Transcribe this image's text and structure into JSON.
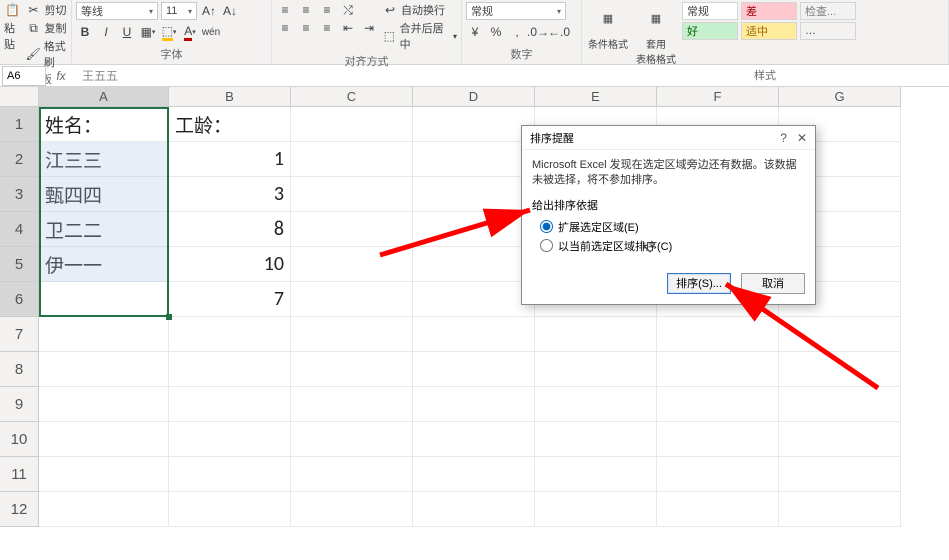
{
  "ribbon": {
    "clipboard": {
      "label": "剪贴板",
      "paste": "粘贴",
      "cut": "剪切",
      "copy": "复制",
      "format_painter": "格式刷"
    },
    "font": {
      "label": "字体",
      "font_name": "等线",
      "font_size": "11",
      "bold": "B",
      "italic": "I",
      "underline": "U"
    },
    "alignment": {
      "label": "对齐方式",
      "wrap": "自动换行",
      "merge": "合并后居中"
    },
    "number": {
      "label": "数字",
      "format": "常规"
    },
    "styles": {
      "label": "样式",
      "conditional": "条件格式",
      "table": "套用\n表格格式",
      "normal": "常规",
      "bad": "差",
      "good": "好",
      "neutral": "适中",
      "check": "检查..."
    }
  },
  "namebox": "A6",
  "formula_value": "王五五",
  "columns": [
    "A",
    "B",
    "C",
    "D",
    "E",
    "F",
    "G"
  ],
  "cells": {
    "A1": "姓名：",
    "B1": "工龄：",
    "A2": "江三三",
    "B2": "1",
    "A3": "甄四四",
    "B3": "3",
    "A4": "卫二二",
    "B4": "8",
    "A5": "伊一一",
    "B5": "10",
    "A6": "王五五",
    "B6": "7"
  },
  "dialog": {
    "title": "排序提醒",
    "msg": "Microsoft Excel 发现在选定区域旁边还有数据。该数据未被选择，将不参加排序。",
    "group_label": "给出排序依据",
    "opt_expand": "扩展选定区域(E)",
    "opt_current": "以当前选定区域排序(C)",
    "btn_sort": "排序(S)...",
    "btn_cancel": "取消"
  }
}
